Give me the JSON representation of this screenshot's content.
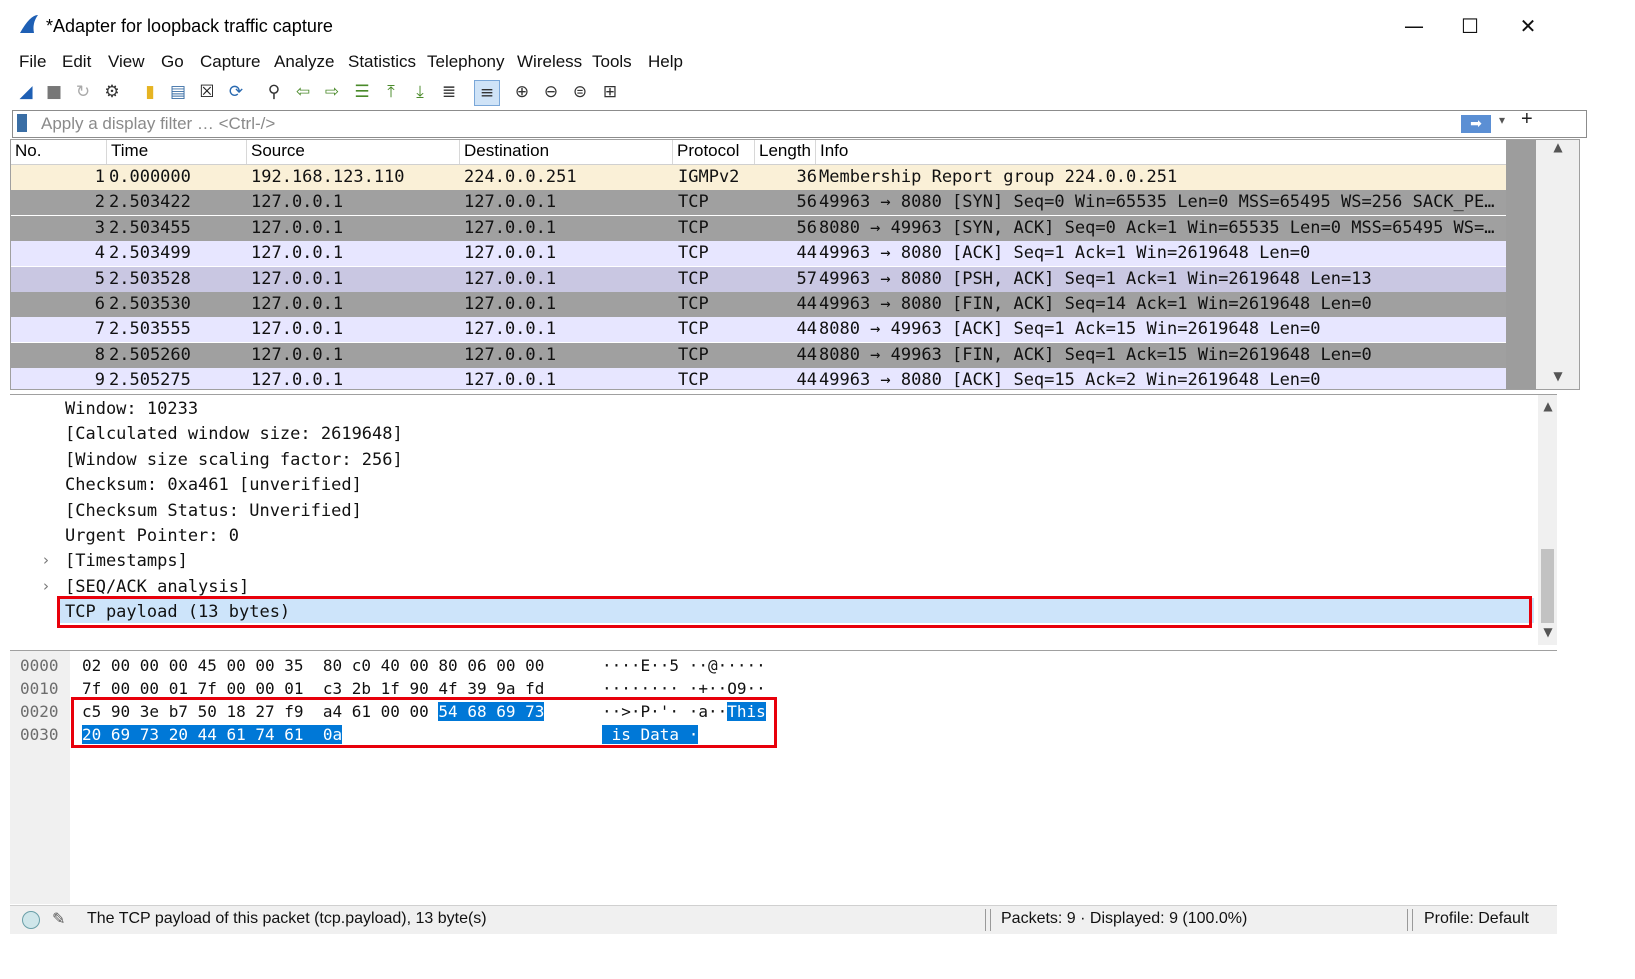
{
  "window": {
    "title": "*Adapter for loopback traffic capture",
    "minimize": "—",
    "maximize": "☐",
    "close": "✕"
  },
  "menu": [
    "File",
    "Edit",
    "View",
    "Go",
    "Capture",
    "Analyze",
    "Statistics",
    "Telephony",
    "Wireless",
    "Tools",
    "Help"
  ],
  "toolbar": {
    "icons": [
      "shark-fin-start-icon",
      "stop-icon",
      "restart-icon",
      "options-gear-icon",
      "open-folder-icon",
      "save-file-icon",
      "close-file-icon",
      "reload-icon",
      "find-icon",
      "go-back-icon",
      "go-forward-icon",
      "go-to-packet-icon",
      "first-packet-icon",
      "last-packet-icon",
      "autoscroll-icon",
      "colorize-icon",
      "zoom-in-icon",
      "zoom-out-icon",
      "zoom-normal-icon",
      "resize-columns-icon"
    ]
  },
  "filter": {
    "placeholder": "Apply a display filter … <Ctrl-/>",
    "add_button": "+"
  },
  "packet_list": {
    "columns": {
      "no": "No.",
      "time": "Time",
      "source": "Source",
      "destination": "Destination",
      "protocol": "Protocol",
      "length": "Length",
      "info": "Info"
    },
    "rows": [
      {
        "no": "1",
        "time": "0.000000",
        "source": "192.168.123.110",
        "destination": "224.0.0.251",
        "protocol": "IGMPv2",
        "length": "36",
        "info": "Membership Report group 224.0.0.251",
        "bg": "#faf0d7"
      },
      {
        "no": "2",
        "time": "2.503422",
        "source": "127.0.0.1",
        "destination": "127.0.0.1",
        "protocol": "TCP",
        "length": "56",
        "info": "49963 → 8080 [SYN] Seq=0 Win=65535 Len=0 MSS=65495 WS=256 SACK_PE…",
        "bg": "#a0a0a0"
      },
      {
        "no": "3",
        "time": "2.503455",
        "source": "127.0.0.1",
        "destination": "127.0.0.1",
        "protocol": "TCP",
        "length": "56",
        "info": "8080 → 49963 [SYN, ACK] Seq=0 Ack=1 Win=65535 Len=0 MSS=65495 WS=…",
        "bg": "#a0a0a0"
      },
      {
        "no": "4",
        "time": "2.503499",
        "source": "127.0.0.1",
        "destination": "127.0.0.1",
        "protocol": "TCP",
        "length": "44",
        "info": "49963 → 8080 [ACK] Seq=1 Ack=1 Win=2619648 Len=0",
        "bg": "#e7e6ff"
      },
      {
        "no": "5",
        "time": "2.503528",
        "source": "127.0.0.1",
        "destination": "127.0.0.1",
        "protocol": "TCP",
        "length": "57",
        "info": "49963 → 8080 [PSH, ACK] Seq=1 Ack=1 Win=2619648 Len=13",
        "bg": "#c9c7e2"
      },
      {
        "no": "6",
        "time": "2.503530",
        "source": "127.0.0.1",
        "destination": "127.0.0.1",
        "protocol": "TCP",
        "length": "44",
        "info": "49963 → 8080 [FIN, ACK] Seq=14 Ack=1 Win=2619648 Len=0",
        "bg": "#a0a0a0"
      },
      {
        "no": "7",
        "time": "2.503555",
        "source": "127.0.0.1",
        "destination": "127.0.0.1",
        "protocol": "TCP",
        "length": "44",
        "info": "8080 → 49963 [ACK] Seq=1 Ack=15 Win=2619648 Len=0",
        "bg": "#e7e6ff"
      },
      {
        "no": "8",
        "time": "2.505260",
        "source": "127.0.0.1",
        "destination": "127.0.0.1",
        "protocol": "TCP",
        "length": "44",
        "info": "8080 → 49963 [FIN, ACK] Seq=1 Ack=15 Win=2619648 Len=0",
        "bg": "#a0a0a0"
      },
      {
        "no": "9",
        "time": "2.505275",
        "source": "127.0.0.1",
        "destination": "127.0.0.1",
        "protocol": "TCP",
        "length": "44",
        "info": "49963 → 8080 [ACK] Seq=15 Ack=2 Win=2619648 Len=0",
        "bg": "#e7e6ff"
      }
    ]
  },
  "details": {
    "lines": [
      {
        "text": "Window: 10233",
        "expandable": false
      },
      {
        "text": "[Calculated window size: 2619648]",
        "expandable": false
      },
      {
        "text": "[Window size scaling factor: 256]",
        "expandable": false
      },
      {
        "text": "Checksum: 0xa461 [unverified]",
        "expandable": false
      },
      {
        "text": "[Checksum Status: Unverified]",
        "expandable": false
      },
      {
        "text": "Urgent Pointer: 0",
        "expandable": false
      },
      {
        "text": "[Timestamps]",
        "expandable": true
      },
      {
        "text": "[SEQ/ACK analysis]",
        "expandable": true
      },
      {
        "text": "TCP payload (13 bytes)",
        "expandable": false,
        "selected": true
      }
    ],
    "caret": "›"
  },
  "bytes": {
    "rows": [
      {
        "offset": "0000",
        "hex": "02 00 00 00 45 00 00 35  80 c0 40 00 80 06 00 00",
        "hex_hl": "",
        "ascii": "····E··5 ··@·····",
        "ascii_hl": ""
      },
      {
        "offset": "0010",
        "hex": "7f 00 00 01 7f 00 00 01  c3 2b 1f 90 4f 39 9a fd",
        "hex_hl": "",
        "ascii": "········ ·+··O9··",
        "ascii_hl": ""
      },
      {
        "offset": "0020",
        "hex": "c5 90 3e b7 50 18 27 f9  a4 61 00 00 ",
        "hex_hl": "54 68 69 73",
        "ascii": "··>·P·'· ·a··",
        "ascii_hl": "This"
      },
      {
        "offset": "0030",
        "hex": "",
        "hex_hl": "20 69 73 20 44 61 74 61  0a",
        "ascii": "",
        "ascii_hl": " is Data ·"
      }
    ]
  },
  "status": {
    "message": "The TCP payload of this packet (tcp.payload), 13 byte(s)",
    "packets": "Packets: 9 · Displayed: 9 (100.0%)",
    "profile": "Profile: Default"
  }
}
